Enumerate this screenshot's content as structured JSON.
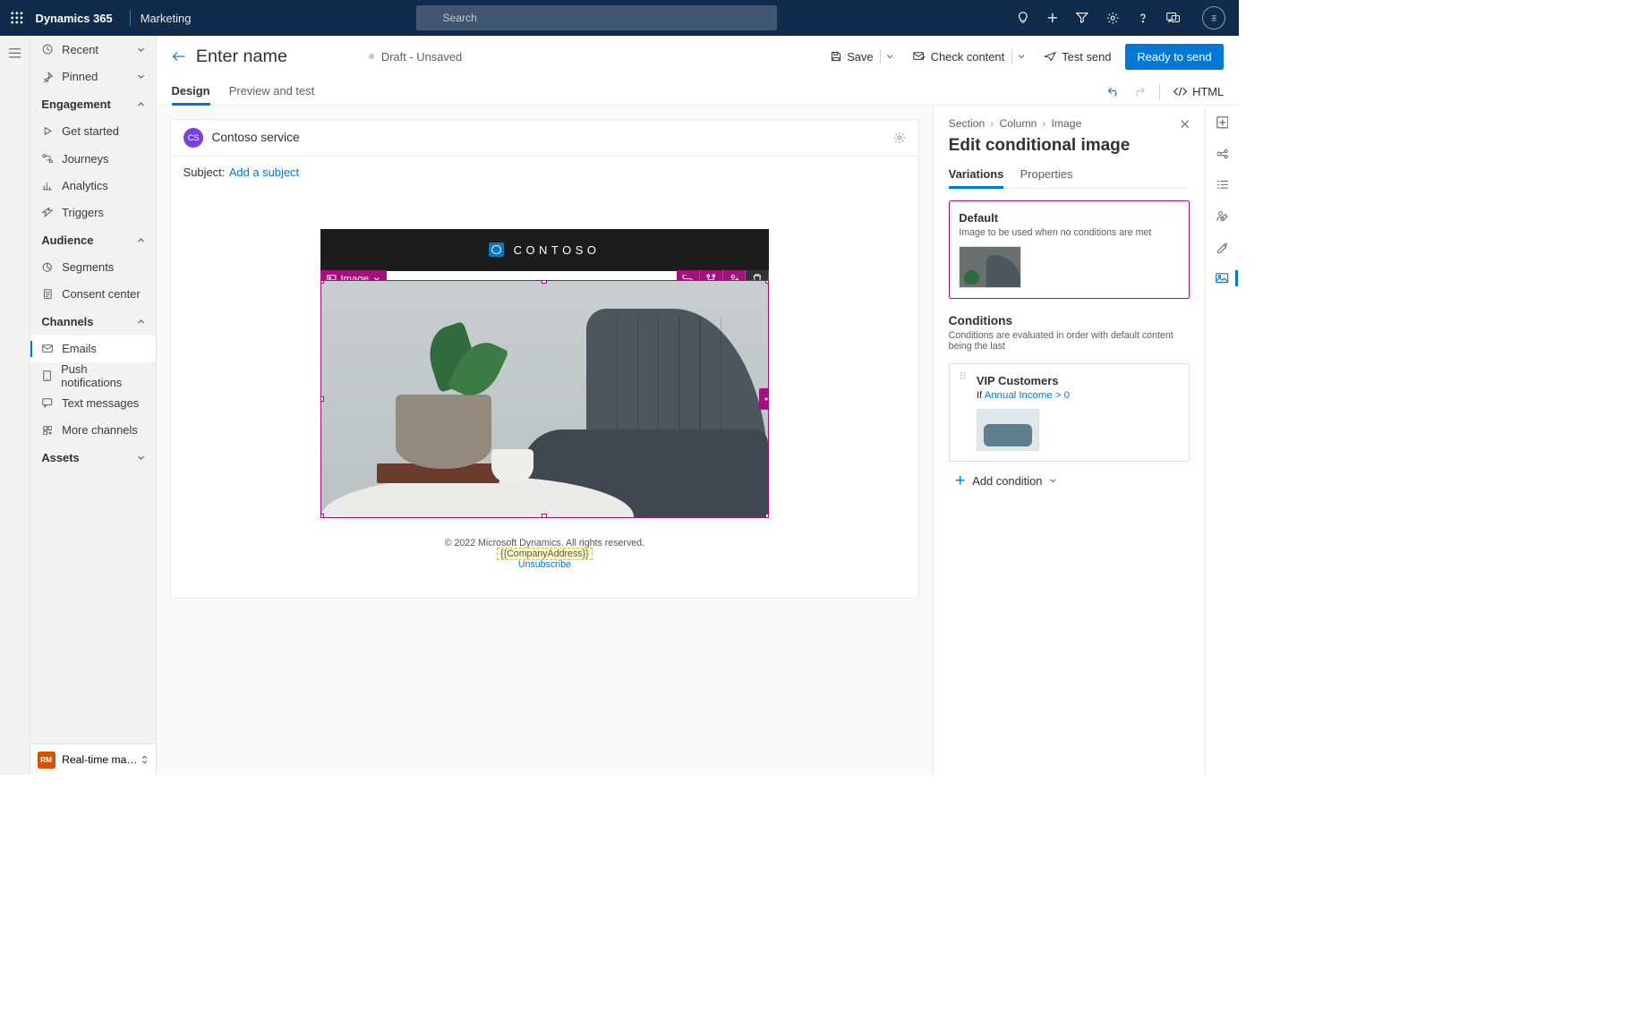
{
  "top": {
    "brand": "Dynamics 365",
    "app": "Marketing",
    "search_placeholder": "Search"
  },
  "sidebar": {
    "recent": "Recent",
    "pinned": "Pinned",
    "groups": {
      "engagement": "Engagement",
      "audience": "Audience",
      "channels": "Channels",
      "assets": "Assets"
    },
    "engagement_items": [
      "Get started",
      "Journeys",
      "Analytics",
      "Triggers"
    ],
    "audience_items": [
      "Segments",
      "Consent center"
    ],
    "channels_items": [
      "Emails",
      "Push notifications",
      "Text messages",
      "More channels"
    ],
    "foot": "Real-time marketi…",
    "foot_badge": "RM"
  },
  "page": {
    "title": "Enter name",
    "status": "Draft - Unsaved",
    "actions": {
      "save": "Save",
      "check": "Check content",
      "test": "Test send",
      "ready": "Ready to send",
      "html": "HTML"
    },
    "tabs": {
      "design": "Design",
      "preview": "Preview and test"
    }
  },
  "canvas": {
    "sender": "Contoso service",
    "sender_badge": "CS",
    "subject_label": "Subject:",
    "subject_link": "Add a subject",
    "brand": "CONTOSO",
    "image_label": "Image",
    "footer": {
      "copyright": "© 2022 Microsoft Dynamics. All rights reserved.",
      "token": "{{CompanyAddress}}",
      "unsub": "Unsubscribe"
    }
  },
  "panel": {
    "crumbs": [
      "Section",
      "Column",
      "Image"
    ],
    "title": "Edit conditional image",
    "tabs": {
      "variations": "Variations",
      "properties": "Properties"
    },
    "default": {
      "title": "Default",
      "desc": "Image to be used when no conditions are met"
    },
    "conditions_title": "Conditions",
    "conditions_desc": "Conditions are evaluated in order with default content being the last",
    "cond1": {
      "title": "VIP Customers",
      "if": "If ",
      "attr": "Annual Income > 0"
    },
    "add": "Add condition"
  }
}
